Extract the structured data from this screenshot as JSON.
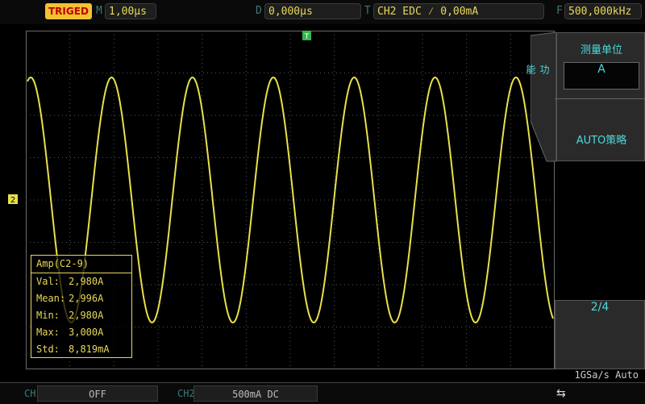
{
  "topbar": {
    "trig_status": "TRIGED",
    "timebase_label": "M",
    "timebase_value": "1,00µs",
    "delay_label": "D",
    "delay_value": "0,000µs",
    "trigger_label": "T",
    "trigger_value": "CH2 EDC ⁄  0,00mA",
    "freq_label": "F",
    "freq_value": "500,000kHz"
  },
  "markers": {
    "trigger_pos": "T",
    "channel": "2"
  },
  "panel": {
    "function_label": "功能",
    "unit_title": "测量单位",
    "unit_value": "A",
    "auto_strategy": "AUTO策略",
    "page": "2/4"
  },
  "sample_rate": "1GSa/s Auto",
  "measurement": {
    "title": "Amp(C2-9)",
    "rows": [
      {
        "key": "Val:",
        "value": "2,980A"
      },
      {
        "key": "Mean:",
        "value": "2,996A"
      },
      {
        "key": "Min:",
        "value": "2,980A"
      },
      {
        "key": "Max:",
        "value": "3,000A"
      },
      {
        "key": "Std:",
        "value": "8,819mA"
      }
    ]
  },
  "bottombar": {
    "ch1_label": "CH1",
    "ch1_value": "OFF",
    "ch2_label": "CH2",
    "ch2_value": "500mA DC"
  },
  "waveform": {
    "color": "#e8e04a",
    "cycles": 6.5
  },
  "colors": {
    "trace": "#e8e04a",
    "menu_text": "#4fd8d8",
    "badge": "#f2c230"
  },
  "icons": {
    "usb": "usb-icon"
  }
}
